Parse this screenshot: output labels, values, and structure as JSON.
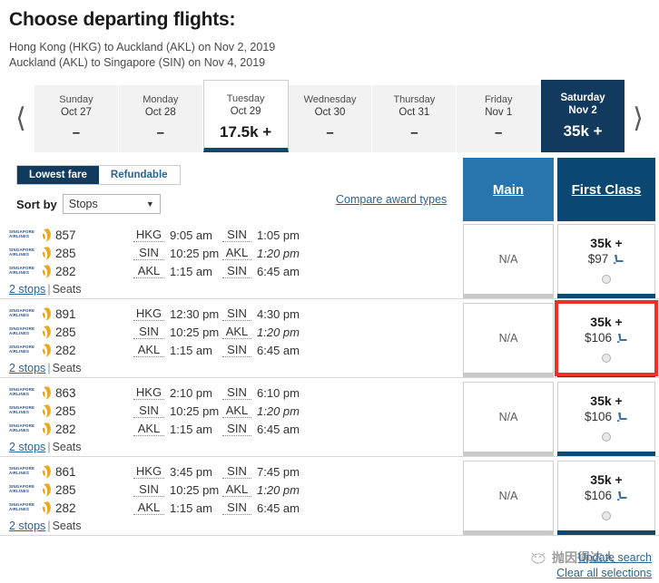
{
  "header": {
    "title": "Choose departing flights:",
    "itinerary": [
      "Hong Kong (HKG) to Auckland (AKL) on Nov 2, 2019",
      "Auckland (AKL) to Singapore (SIN) on Nov 4, 2019"
    ]
  },
  "date_strip": {
    "prev_icon": "chevron-left-icon",
    "next_icon": "chevron-right-icon",
    "tabs": [
      {
        "dow": "Sunday",
        "day": "Oct 27",
        "price": "–",
        "state": "normal"
      },
      {
        "dow": "Monday",
        "day": "Oct 28",
        "price": "–",
        "state": "normal"
      },
      {
        "dow": "Tuesday",
        "day": "Oct 29",
        "price": "17.5k +",
        "state": "selected"
      },
      {
        "dow": "Wednesday",
        "day": "Oct 30",
        "price": "–",
        "state": "normal"
      },
      {
        "dow": "Thursday",
        "day": "Oct 31",
        "price": "–",
        "state": "normal"
      },
      {
        "dow": "Friday",
        "day": "Nov 1",
        "price": "–",
        "state": "normal"
      },
      {
        "dow": "Saturday",
        "day": "Nov 2",
        "price": "35k +",
        "state": "active"
      }
    ]
  },
  "controls": {
    "fare_toggle": {
      "lowest_fare": "Lowest fare",
      "refundable": "Refundable",
      "active": "Lowest fare"
    },
    "sort_label": "Sort by",
    "sort_value": "Stops",
    "sort_options": [
      "Stops"
    ],
    "compare_link": "Compare award types"
  },
  "columns": [
    {
      "key": "main",
      "label": "Main",
      "color": "#2a74ad"
    },
    {
      "key": "first",
      "label": "First Class",
      "color": "#0a4872"
    }
  ],
  "results": [
    {
      "segments": [
        {
          "airline": "Singapore Airlines",
          "flight": "857",
          "orig": "HKG",
          "dep": "9:05 am",
          "dest": "SIN",
          "arr": "1:05 pm",
          "next_day": false
        },
        {
          "airline": "Singapore Airlines",
          "flight": "285",
          "orig": "SIN",
          "dep": "10:25 pm",
          "dest": "AKL",
          "arr": "1:20 pm",
          "next_day": true
        },
        {
          "airline": "Singapore Airlines",
          "flight": "282",
          "orig": "AKL",
          "dep": "1:15 am",
          "dest": "SIN",
          "arr": "6:45 am",
          "next_day": false
        }
      ],
      "stops": "2 stops",
      "seats": "Seats",
      "main": {
        "available": false,
        "text": "N/A"
      },
      "first": {
        "available": true,
        "miles": "35k +",
        "cash": "$97",
        "seat_icon": "seat-icon",
        "selected": false
      }
    },
    {
      "segments": [
        {
          "airline": "Singapore Airlines",
          "flight": "891",
          "orig": "HKG",
          "dep": "12:30 pm",
          "dest": "SIN",
          "arr": "4:30 pm",
          "next_day": false
        },
        {
          "airline": "Singapore Airlines",
          "flight": "285",
          "orig": "SIN",
          "dep": "10:25 pm",
          "dest": "AKL",
          "arr": "1:20 pm",
          "next_day": true
        },
        {
          "airline": "Singapore Airlines",
          "flight": "282",
          "orig": "AKL",
          "dep": "1:15 am",
          "dest": "SIN",
          "arr": "6:45 am",
          "next_day": false
        }
      ],
      "stops": "2 stops",
      "seats": "Seats",
      "main": {
        "available": false,
        "text": "N/A"
      },
      "first": {
        "available": true,
        "miles": "35k +",
        "cash": "$106",
        "seat_icon": "seat-icon",
        "selected": true
      }
    },
    {
      "segments": [
        {
          "airline": "Singapore Airlines",
          "flight": "863",
          "orig": "HKG",
          "dep": "2:10 pm",
          "dest": "SIN",
          "arr": "6:10 pm",
          "next_day": false
        },
        {
          "airline": "Singapore Airlines",
          "flight": "285",
          "orig": "SIN",
          "dep": "10:25 pm",
          "dest": "AKL",
          "arr": "1:20 pm",
          "next_day": true
        },
        {
          "airline": "Singapore Airlines",
          "flight": "282",
          "orig": "AKL",
          "dep": "1:15 am",
          "dest": "SIN",
          "arr": "6:45 am",
          "next_day": false
        }
      ],
      "stops": "2 stops",
      "seats": "Seats",
      "main": {
        "available": false,
        "text": "N/A"
      },
      "first": {
        "available": true,
        "miles": "35k +",
        "cash": "$106",
        "seat_icon": "seat-icon",
        "selected": false
      }
    },
    {
      "segments": [
        {
          "airline": "Singapore Airlines",
          "flight": "861",
          "orig": "HKG",
          "dep": "3:45 pm",
          "dest": "SIN",
          "arr": "7:45 pm",
          "next_day": false
        },
        {
          "airline": "Singapore Airlines",
          "flight": "285",
          "orig": "SIN",
          "dep": "10:25 pm",
          "dest": "AKL",
          "arr": "1:20 pm",
          "next_day": true
        },
        {
          "airline": "Singapore Airlines",
          "flight": "282",
          "orig": "AKL",
          "dep": "1:15 am",
          "dest": "SIN",
          "arr": "6:45 am",
          "next_day": false
        }
      ],
      "stops": "2 stops",
      "seats": "Seats",
      "main": {
        "available": false,
        "text": "N/A"
      },
      "first": {
        "available": true,
        "miles": "35k +",
        "cash": "$106",
        "seat_icon": "seat-icon",
        "selected": false
      }
    }
  ],
  "footer": {
    "update_search": "Update search",
    "clear_all": "Clear all selections"
  },
  "watermark": {
    "text": "抛因得达人"
  },
  "logo": {
    "line1": "SINGAPORE",
    "line2": "AIRLINES"
  },
  "colors": {
    "navy": "#123a5e",
    "main_blue": "#2a74ad",
    "first_navy": "#0a4872",
    "link": "#2a6496",
    "highlight": "#ee3124",
    "sq_blue": "#28508c",
    "sq_gold": "#e8aa1e"
  }
}
